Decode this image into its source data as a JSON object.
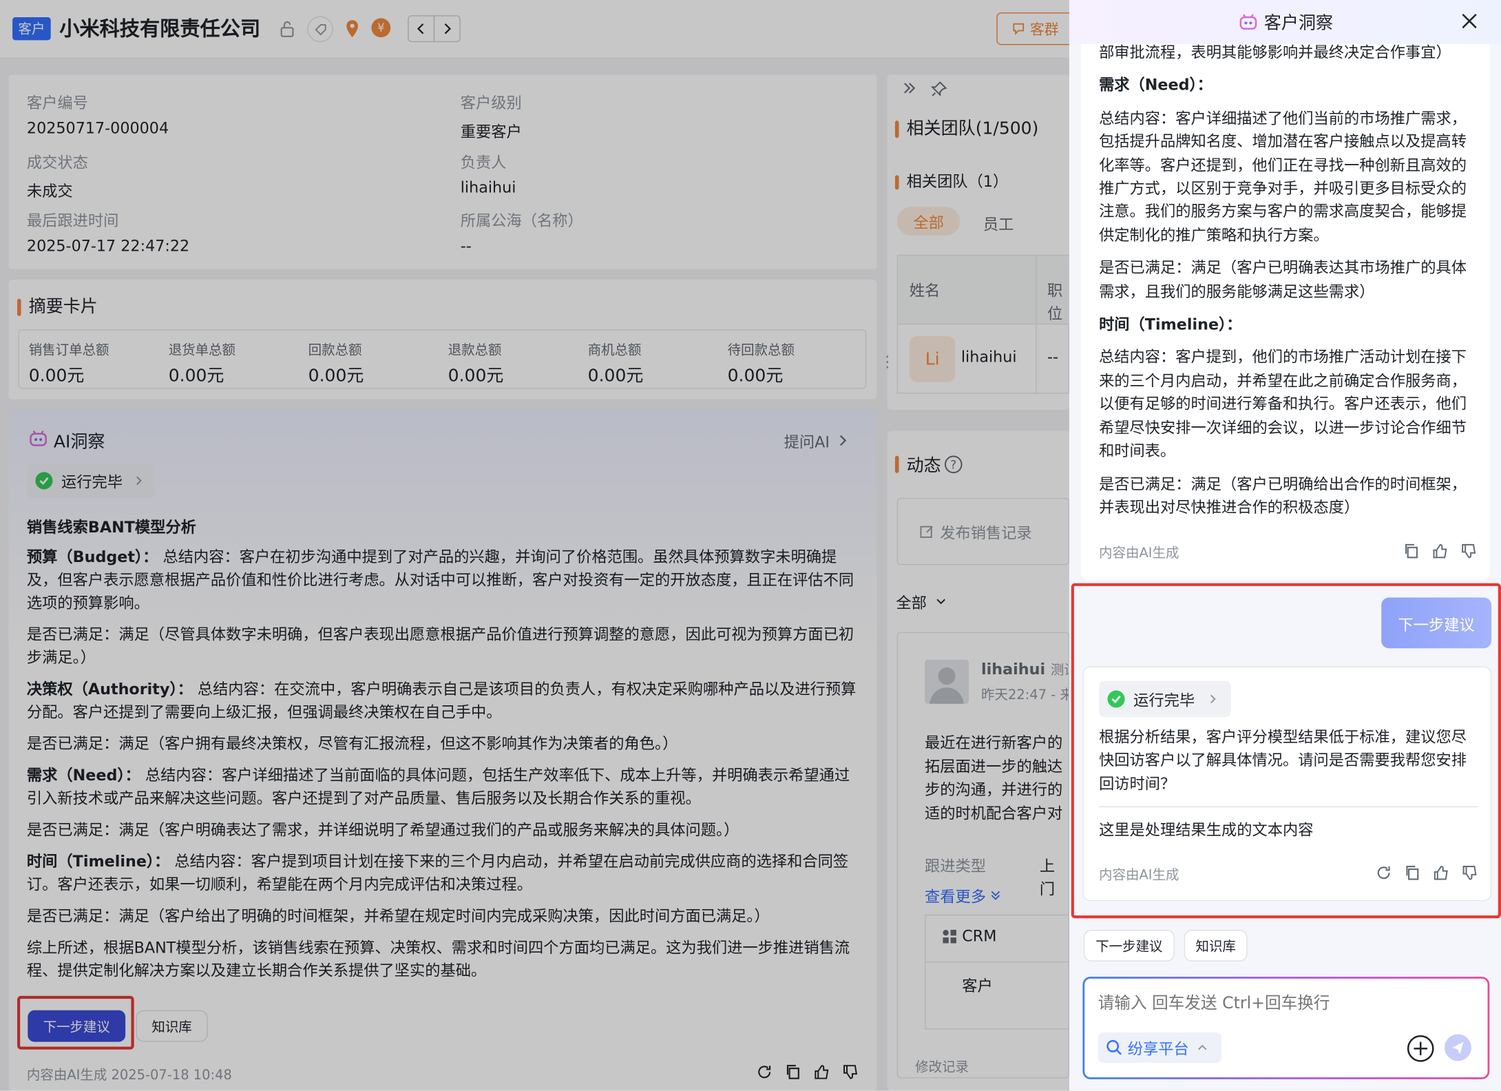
{
  "header": {
    "tag": "客户",
    "title": "小米科技有限责任公司",
    "group_btn": "客群"
  },
  "info": {
    "items": [
      {
        "label": "客户编号",
        "value": "20250717-000004"
      },
      {
        "label": "客户级别",
        "value": "重要客户"
      },
      {
        "label": "成交状态",
        "value": "未成交"
      },
      {
        "label": "负责人",
        "value": "lihaihui"
      },
      {
        "label": "最后跟进时间",
        "value": "2025-07-17 22:47:22"
      },
      {
        "label": "所属公海（名称）",
        "value": "--"
      }
    ]
  },
  "summary": {
    "title": "摘要卡片",
    "items": [
      {
        "label": "销售订单总额",
        "value": "0.00元"
      },
      {
        "label": "退货单总额",
        "value": "0.00元"
      },
      {
        "label": "回款总额",
        "value": "0.00元"
      },
      {
        "label": "退款总额",
        "value": "0.00元"
      },
      {
        "label": "商机总额",
        "value": "0.00元"
      },
      {
        "label": "待回款总额",
        "value": "0.00元"
      }
    ]
  },
  "ai": {
    "title": "AI洞察",
    "ask": "提问AI",
    "status": "运行完毕",
    "heading": "销售线索BANT模型分析",
    "paras": [
      {
        "b": "预算（Budget）：",
        "t": " 总结内容：客户在初步沟通中提到了对产品的兴趣，并询问了价格范围。虽然具体预算数字未明确提及，但客户表示愿意根据产品价值和性价比进行考虑。从对话中可以推断，客户对投资有一定的开放态度，且正在评估不同选项的预算影响。"
      },
      {
        "b": "",
        "t": "是否已满足：满足（尽管具体数字未明确，但客户表现出愿意根据产品价值进行预算调整的意愿，因此可视为预算方面已初步满足。）"
      },
      {
        "b": "决策权（Authority）：",
        "t": " 总结内容：在交流中，客户明确表示自己是该项目的负责人，有权决定采购哪种产品以及进行预算分配。客户还提到了需要向上级汇报，但强调最终决策权在自己手中。"
      },
      {
        "b": "",
        "t": "是否已满足：满足（客户拥有最终决策权，尽管有汇报流程，但这不影响其作为决策者的角色。）"
      },
      {
        "b": "需求（Need）：",
        "t": " 总结内容：客户详细描述了当前面临的具体问题，包括生产效率低下、成本上升等，并明确表示希望通过引入新技术或产品来解决这些问题。客户还提到了对产品质量、售后服务以及长期合作关系的重视。"
      },
      {
        "b": "",
        "t": "是否已满足：满足（客户明确表达了需求，并详细说明了希望通过我们的产品或服务来解决的具体问题。）"
      },
      {
        "b": "时间（Timeline）：",
        "t": " 总结内容：客户提到项目计划在接下来的三个月内启动，并希望在启动前完成供应商的选择和合同签订。客户还表示，如果一切顺利，希望能在两个月内完成评估和决策过程。"
      },
      {
        "b": "",
        "t": "是否已满足：满足（客户给出了明确的时间框架，并希望在规定时间内完成采购决策，因此时间方面已满足。）"
      },
      {
        "b": "",
        "t": "综上所述，根据BANT模型分析，该销售线索在预算、决策权、需求和时间四个方面均已满足。这为我们进一步推进销售流程、提供定制化解决方案以及建立长期合作关系提供了坚实的基础。"
      }
    ],
    "btn_next": "下一步建议",
    "btn_kb": "知识库",
    "footer": "内容由AI生成 2025-07-18 10:48"
  },
  "team": {
    "title": "相关团队(1/500)",
    "sub": "相关团队（1）",
    "tab_all": "全部",
    "tab_staff": "员工",
    "col_name": "姓名",
    "col_pos": "职位",
    "member_avatar": "Li",
    "member_name": "lihaihui",
    "member_pos": "--"
  },
  "feed": {
    "title": "动态",
    "publish": "发布销售记录",
    "filter": "全部",
    "author": "lihaihui",
    "author_tag": "测试",
    "time": "昨天22:47 - 来",
    "body": [
      "最近在进行新客户的",
      "拓层面进一步的触达",
      "步的沟通，并进行的",
      "适的时机配合客户对"
    ],
    "type_label": "跟进类型",
    "type_val": "上门",
    "more": "查看更多",
    "crm": "CRM",
    "crm_item": "客户",
    "log": "修改记录"
  },
  "panel": {
    "title": "客户洞察",
    "paras": [
      {
        "b": "",
        "t": "部审批流程，表明其能够影响并最终决定合作事宜）"
      },
      {
        "b": "需求（Need）：",
        "t": ""
      },
      {
        "b": "",
        "t": "总结内容：客户详细描述了他们当前的市场推广需求，包括提升品牌知名度、增加潜在客户接触点以及提高转化率等。客户还提到，他们正在寻找一种创新且高效的推广方式，以区别于竞争对手，并吸引更多目标受众的注意。我们的服务方案与客户的需求高度契合，能够提供定制化的推广策略和执行方案。"
      },
      {
        "b": "",
        "t": "是否已满足：满足（客户已明确表达其市场推广的具体需求，且我们的服务能够满足这些需求）"
      },
      {
        "b": "时间（Timeline）：",
        "t": ""
      },
      {
        "b": "",
        "t": "总结内容：客户提到，他们的市场推广活动计划在接下来的三个月内启动，并希望在此之前确定合作服务商，以便有足够的时间进行筹备和执行。客户还表示，他们希望尽快安排一次详细的会议，以进一步讨论合作细节和时间表。"
      },
      {
        "b": "",
        "t": "是否已满足：满足（客户已明确给出合作的时间框架，并表现出对尽快推进合作的积极态度）"
      }
    ],
    "ai_note": "内容由AI生成",
    "user_msg": "下一步建议",
    "status": "运行完毕",
    "reply": "根据分析结果，客户评分模型结果低于标准，建议您尽快回访客户以了解具体情况。请问是否需要我帮您安排回访时间？",
    "reply2": "这里是处理结果生成的文本内容",
    "quick1": "下一步建议",
    "quick2": "知识库",
    "placeholder": "请输入 回车发送 Ctrl+回车换行",
    "platform": "纷享平台"
  },
  "colors": {
    "accent": "#3b5bdb",
    "orange": "#f0883e",
    "highlight": "#e53935",
    "green": "#34c759"
  }
}
